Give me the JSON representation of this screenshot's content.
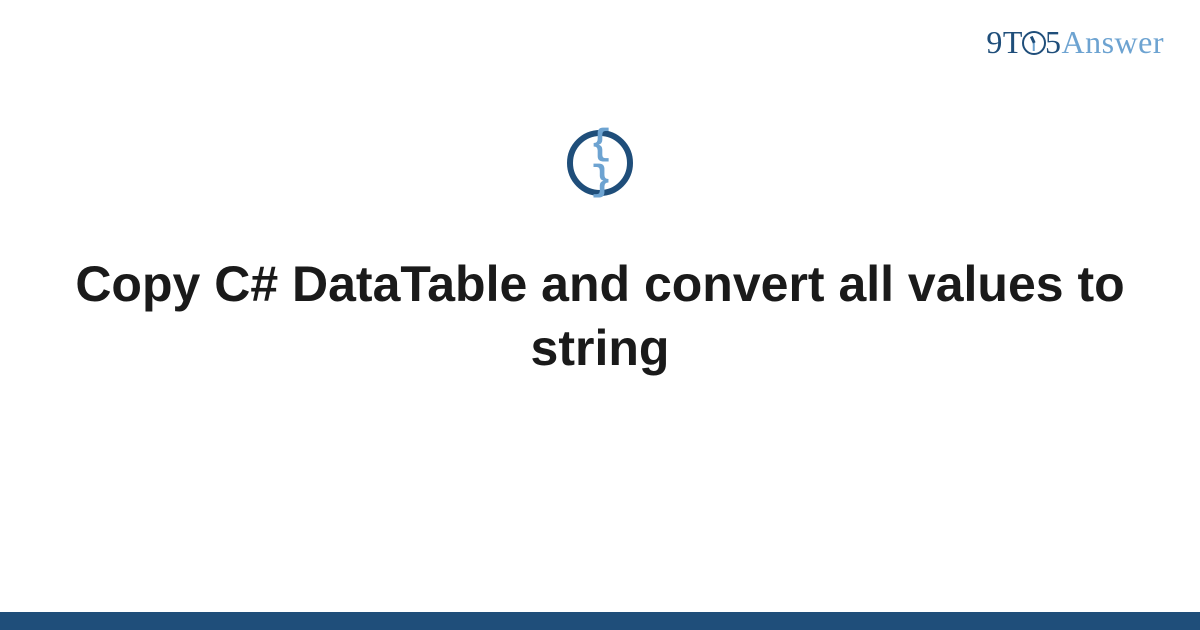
{
  "brand": {
    "part1": "9T",
    "part2": "5",
    "part3": "Answer"
  },
  "icon": {
    "name": "code-braces-icon",
    "glyph": "{ }"
  },
  "title": "Copy C# DataTable and convert all values to string",
  "colors": {
    "primary": "#1f4e7a",
    "accent": "#6da3d1"
  }
}
